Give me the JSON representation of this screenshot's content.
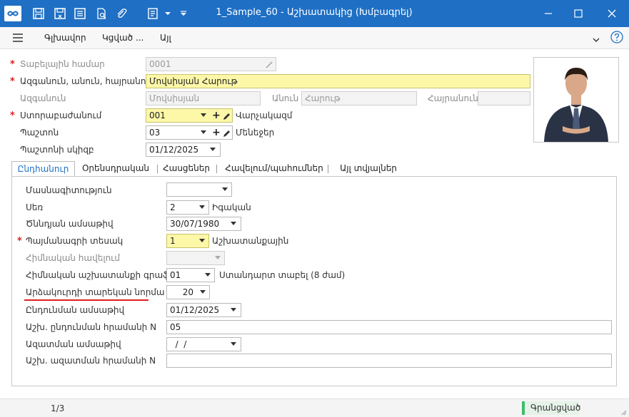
{
  "window": {
    "title": "1_Sample_60 - Աշխատակից (Խմբագրել)"
  },
  "menu": {
    "items": [
      "Գլխավոր",
      "Կցված ...",
      "Այլ"
    ]
  },
  "colors": {
    "accent": "#1f6fc4",
    "required": "#d62020",
    "highlight": "#fdf7a8",
    "status": "#3dbb6e"
  },
  "fields": {
    "tab_number": {
      "label": "Տաբելային համար",
      "value": "0001"
    },
    "full_name": {
      "label": "Ազգանուն, անուն, հայրանուն",
      "value": "Մովսիսյան Հարութ"
    },
    "surname": {
      "label": "Ազգանուն",
      "value": "Մովսիսյան"
    },
    "first_name": {
      "label": "Անուն",
      "value": "Հարութ"
    },
    "patronymic": {
      "label": "Հայրանուն",
      "value": ""
    },
    "department": {
      "label": "Ստորաբաժանում",
      "value": "001",
      "desc": "Վարչակազմ"
    },
    "position": {
      "label": "Պաշտոն",
      "value": "03",
      "desc": "Մենեջեր"
    },
    "position_start": {
      "label": "Պաշտոնի սկիզբ",
      "value": "01/12/2025"
    }
  },
  "tabs": [
    "Ընդհանուր",
    "Օրենսդրական",
    "Հասցեներ",
    "Հավելում/պահումներ",
    "Այլ տվյալներ"
  ],
  "general": {
    "specialty": {
      "label": "Մասնագիտություն",
      "value": ""
    },
    "gender": {
      "label": "Սեռ",
      "value": "2",
      "desc": "Իգական"
    },
    "birth_date": {
      "label": "Ծննդյան ամսաթիվ",
      "value": "30/07/1980"
    },
    "contract_type": {
      "label": "Պայմանագրի տեսակ",
      "value": "1",
      "desc": "Աշխատանքային"
    },
    "base_addition": {
      "label": "Հիմնական հավելում",
      "value": ""
    },
    "schedule": {
      "label": "Հիմնական աշխատանքի գրաֆիկ",
      "value": "01",
      "desc": "Ստանդարտ տաբել (8 ժամ)"
    },
    "vacation_norm": {
      "label": "Արձակուրդի տարեկան նորմա",
      "value": "20"
    },
    "hire_date": {
      "label": "Ընդունման ամսաթիվ",
      "value": "01/12/2025"
    },
    "hire_order": {
      "label": "Աշխ. ընդունման հրամանի N",
      "value": "05"
    },
    "release_date": {
      "label": "Ազատման ամսաթիվ",
      "value": "  /  /"
    },
    "release_order": {
      "label": "Աշխ. ազատման հրամանի N",
      "value": ""
    }
  },
  "status": {
    "page": "1/3",
    "state": "Գրանցված"
  }
}
